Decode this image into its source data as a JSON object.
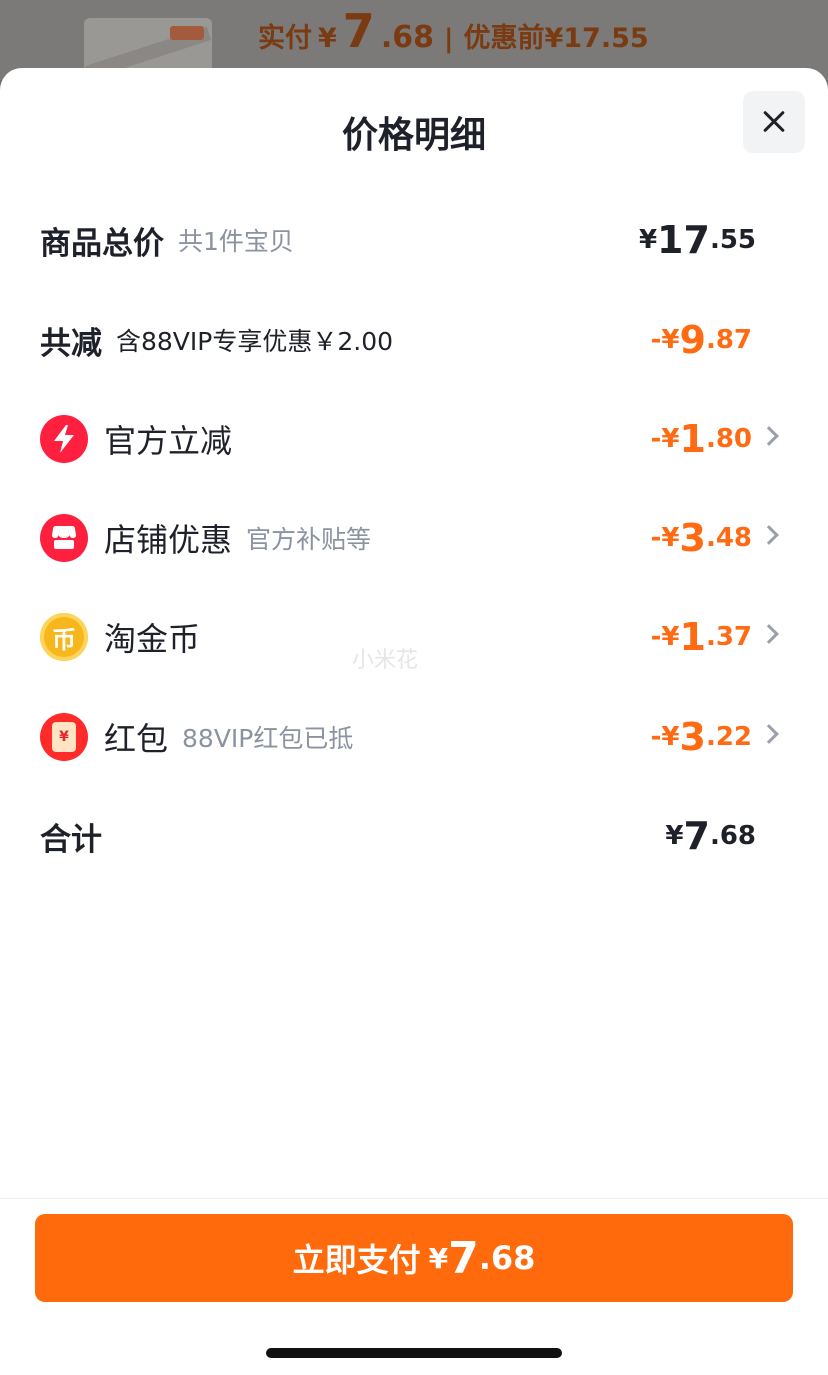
{
  "background_header": {
    "paid_label": "实付",
    "currency": "¥",
    "paid_int": "7",
    "paid_dec": ".68",
    "separator": "|",
    "before_discount": "优惠前¥17.55"
  },
  "sheet": {
    "title": "价格明细",
    "close_icon": "close-icon"
  },
  "rows": {
    "total": {
      "label": "商品总价",
      "note": "共1件宝贝",
      "currency": "¥",
      "int": "17",
      "dec": ".55"
    },
    "reduction": {
      "label": "共减",
      "note": "含88VIP专享优惠￥2.00",
      "sign": "-",
      "currency": "¥",
      "int": "9",
      "dec": ".87"
    },
    "items": [
      {
        "label": "官方立减",
        "note": "",
        "icon": "lightning-icon",
        "sign": "-",
        "currency": "¥",
        "int": "1",
        "dec": ".80"
      },
      {
        "label": "店铺优惠",
        "note": "官方补贴等",
        "icon": "shop-icon",
        "sign": "-",
        "currency": "¥",
        "int": "3",
        "dec": ".48"
      },
      {
        "label": "淘金币",
        "note": "",
        "icon": "coin-icon",
        "icon_text": "币",
        "sign": "-",
        "currency": "¥",
        "int": "1",
        "dec": ".37"
      },
      {
        "label": "红包",
        "note": "88VIP红包已抵",
        "icon": "red-envelope-icon",
        "icon_text": "¥",
        "sign": "-",
        "currency": "¥",
        "int": "3",
        "dec": ".22"
      }
    ],
    "sum": {
      "label": "合计",
      "currency": "¥",
      "int": "7",
      "dec": ".68"
    }
  },
  "watermark": "小米花",
  "pay_button": {
    "label": "立即支付",
    "currency": "¥",
    "int": "7",
    "dec": ".68"
  },
  "colors": {
    "accent": "#ff6b0c",
    "discount": "#ff6a12",
    "text": "#1e2129",
    "note": "#8c93a0"
  }
}
